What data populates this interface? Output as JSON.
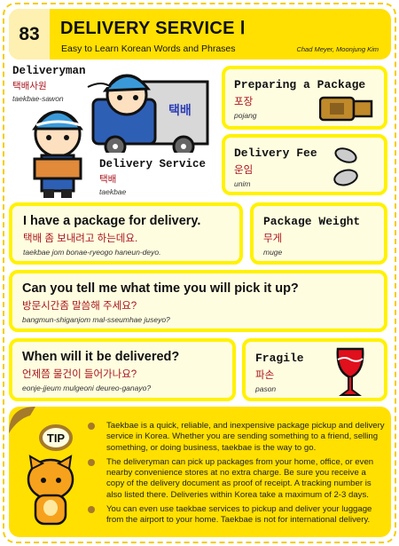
{
  "header": {
    "number": "83",
    "title": "DELIVERY SERVICE Ⅰ",
    "subtitle": "Easy to Learn Korean Words and Phrases",
    "authors": "Chad Meyer,  Moonjung Kim"
  },
  "illustration": {
    "deliveryman": {
      "en": "Deliveryman",
      "kr": "택배사원",
      "rom": "taekbae-sawon"
    },
    "service": {
      "en": "Delivery Service",
      "kr": "택배",
      "rom": "taekbae"
    },
    "truck_label": "택배"
  },
  "words": [
    {
      "en": "Preparing a Package",
      "kr": "포장",
      "rom": "pojang"
    },
    {
      "en": "Delivery Fee",
      "kr": "운임",
      "rom": "unim"
    },
    {
      "en": "Package Weight",
      "kr": "무게",
      "rom": "muge"
    },
    {
      "en": "Fragile",
      "kr": "파손",
      "rom": "pason"
    }
  ],
  "phrases": [
    {
      "en": "I have a package for delivery.",
      "kr": "택배 좀 보내려고 하는데요.",
      "rom": "taekbae jom bonae-ryeogo haneun-deyo."
    },
    {
      "en": "Can you tell me what time you will pick it up?",
      "kr": "방문시간좀 말씀해 주세요?",
      "rom": "bangmun-shiganjom mal-sseumhae juseyo?"
    },
    {
      "en": "When will it be delivered?",
      "kr": "언제쯤 물건이 들어가나요?",
      "rom": "eonje-jjeum mulgeoni deureo-ganayo?"
    }
  ],
  "tip": {
    "label": "TIP",
    "items": [
      "Taekbae is a quick, reliable, and inexpensive package pickup and delivery service in Korea.  Whether you are sending something to a friend, selling something, or doing business, taekbae is the way to go.",
      "The deliveryman can pick up packages from your home, office, or even nearby convenience stores at no extra charge.  Be sure you receive a copy of the delivery document as proof of receipt.  A tracking number is also listed there.  Deliveries within Korea take a maximum of 2-3 days.",
      "You can even use taekbae services to pickup and deliver your luggage from the airport to your home.  Taekbae is not for international delivery."
    ]
  },
  "colors": {
    "yellow": "#ffe000",
    "korean": "#a8141c",
    "cap": "#3a9ad9"
  }
}
